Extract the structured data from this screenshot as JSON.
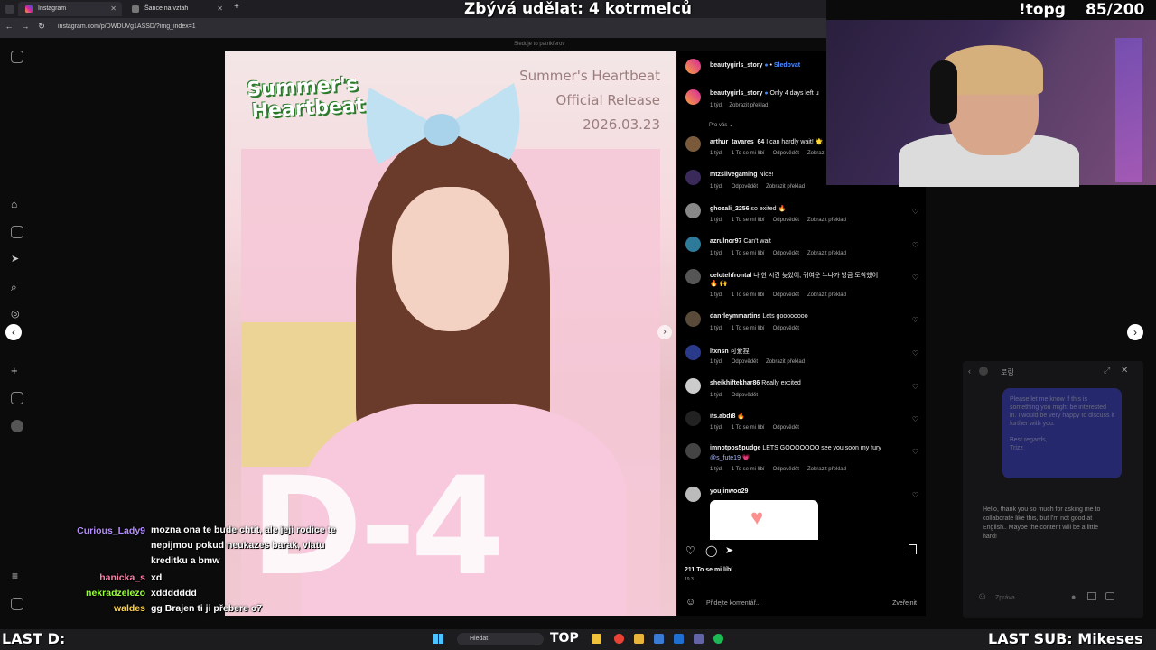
{
  "browser": {
    "tabs": [
      {
        "label": "Instagram",
        "active": true
      },
      {
        "label": "Šance na vztah",
        "active": false
      }
    ],
    "url": "instagram.com/p/DWDUVg1ASSD/?img_index=1"
  },
  "overlay": {
    "goal": "Zbývá udělat: 4 kotrmelců",
    "command": "!topg",
    "counter": "85/200",
    "last_d": "LAST D:",
    "last_sub": "LAST SUB: Mikeses"
  },
  "post": {
    "logo_line1": "Summer's",
    "logo_line2": "Heartbeat",
    "title_lines": [
      "Summer's Heartbeat",
      "Official Release",
      "2026.03.23"
    ],
    "countdown": "D-4",
    "following_hint": "Sleduje to patrikferov"
  },
  "comments_panel": {
    "author": "beautygirls_story",
    "follow_label": "Sledovat",
    "caption_author": "beautygirls_story",
    "caption_text": "Only 4 days left u",
    "caption_time": "1 týd.",
    "caption_translate": "Zobrazit překlad",
    "for_you": "Pro vás",
    "comments": [
      {
        "user": "arthur_tavares_64",
        "text": "I can hardly wait! 🌟",
        "meta": [
          "1 týd.",
          "1 To se mi líbí",
          "Odpovědět",
          "Zobraz"
        ]
      },
      {
        "user": "mtzslivegaming",
        "text": "Nice!",
        "meta": [
          "1 týd.",
          "Odpovědět",
          "Zobrazit překlad"
        ]
      },
      {
        "user": "ghozali_2256",
        "text": "so exited 🔥",
        "meta": [
          "1 týd.",
          "1 To se mi líbí",
          "Odpovědět",
          "Zobrazit překlad"
        ]
      },
      {
        "user": "azrulnor97",
        "text": "Can't wait",
        "meta": [
          "1 týd.",
          "1 To se mi líbí",
          "Odpovědět",
          "Zobrazit překlad"
        ]
      },
      {
        "user": "celotehfrontal",
        "text": "나 한 시간 늦었어, 귀여운 누나가 방금 도착했어",
        "text2": "🔥 🙌",
        "meta": [
          "1 týd.",
          "1 To se mi líbí",
          "Odpovědět",
          "Zobrazit překlad"
        ]
      },
      {
        "user": "danrleymmartins",
        "text": "Lets goooooooo",
        "meta": [
          "1 týd.",
          "1 To se mi líbí",
          "Odpovědět"
        ]
      },
      {
        "user": "ltxnsn",
        "text": "可爱捏",
        "meta": [
          "1 týd.",
          "Odpovědět",
          "Zobrazit překlad"
        ]
      },
      {
        "user": "sheikhiftekhar86",
        "text": "Really excited",
        "meta": [
          "1 týd.",
          "Odpovědět"
        ]
      },
      {
        "user": "its.abdi8",
        "text": "🔥",
        "meta": [
          "1 týd.",
          "1 To se mi líbí",
          "Odpovědět"
        ]
      },
      {
        "user": "imnotpos5pudge",
        "text": "LETS GOOOOOOO see you soon my fury",
        "text2": "@s_fute19 💗",
        "meta": [
          "1 týd.",
          "1 To se mi líbí",
          "Odpovědět",
          "Zobrazit překlad"
        ]
      },
      {
        "user": "youjinwoo29",
        "text": "",
        "meta": []
      }
    ],
    "likes": "211 To se mi líbí",
    "post_date": "19 3.",
    "comment_placeholder": "Přidejte komentář...",
    "publish_label": "Zveřejnit"
  },
  "dm": {
    "title": "로링",
    "message_out": "Please let me know if this is something you might be interested in. I would be very happy to discuss it further with you.\n\nBest regards,\nTrizz",
    "message_in": "Hello, thank you so much for asking me to collaborate like this, but I'm not good at English.. Maybe the content will be a little hard!",
    "input_placeholder": "Zpráva..."
  },
  "chat": [
    {
      "name": "Curious_Lady9",
      "color": "#b58cff",
      "text": "mozna ona te bude chtit, ale jeji rodice te nepijmou pokud neukazes barak, vlatu kreditku a bmw"
    },
    {
      "name": "hanicka_s",
      "color": "#ff7fa8",
      "text": "xd"
    },
    {
      "name": "nekradzelezo",
      "color": "#9bff3c",
      "text": "xddddddd"
    },
    {
      "name": "waldes",
      "color": "#ffd24a",
      "text": "gg Brajen ti ji přebere o7"
    }
  ],
  "taskbar": {
    "search_placeholder": "Hledat",
    "top_badge": "TOP"
  }
}
